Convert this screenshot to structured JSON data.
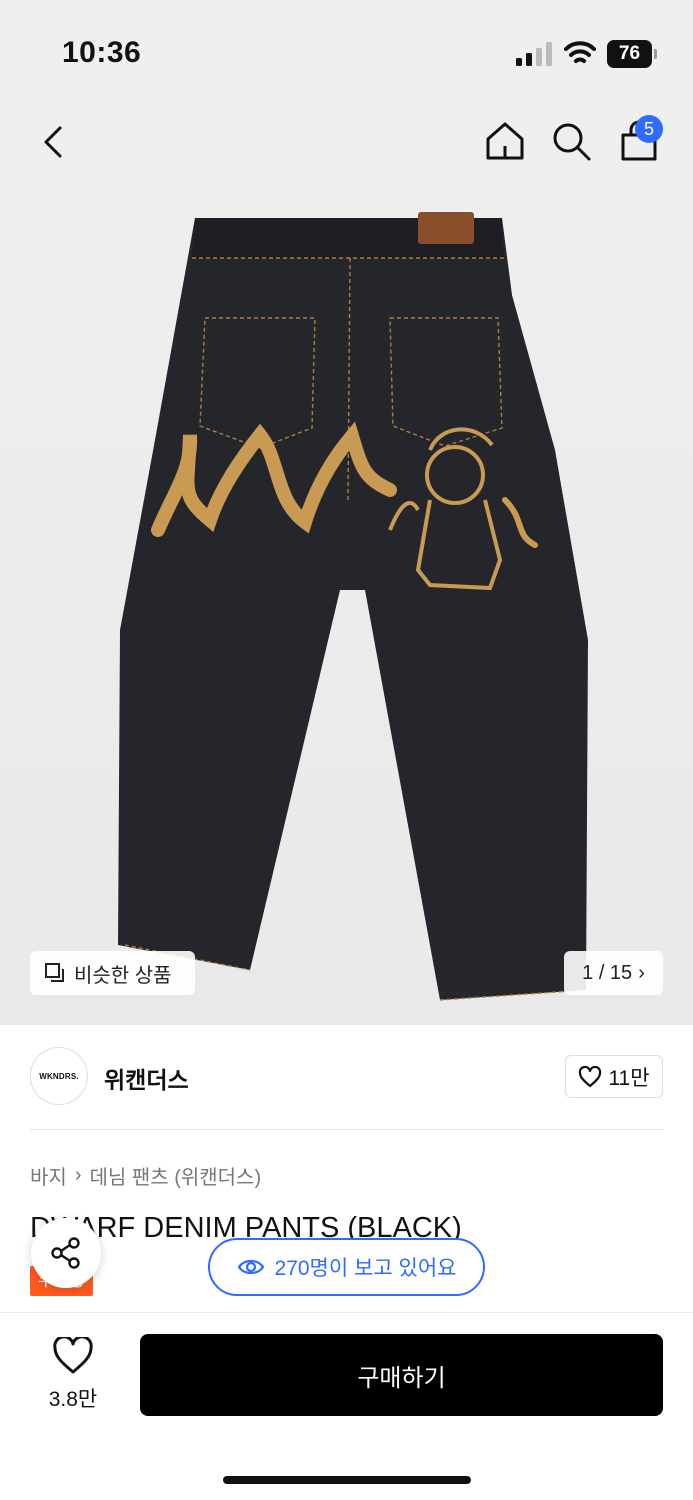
{
  "status_bar": {
    "time": "10:36",
    "battery": "76"
  },
  "nav": {
    "cart_count": "5"
  },
  "gallery": {
    "similar_label": "비슷한 상품",
    "counter": "1 / 15"
  },
  "brand": {
    "logo_text": "WKNDRS.",
    "name": "위캔더스",
    "likes": "11만"
  },
  "breadcrumb": {
    "category": "바지",
    "subcategory": "데님 팬츠 (위캔더스)"
  },
  "product": {
    "title": "DWARF DENIM PANTS (BLACK)",
    "badge": "무진장"
  },
  "viewers": {
    "label": "270명이 보고 있어요"
  },
  "bottom_bar": {
    "wish_count": "3.8만",
    "buy_label": "구매하기"
  },
  "colors": {
    "accent": "#2f6bff",
    "badge": "#ff5a1f",
    "denim": "#23252b",
    "embroidery": "#c99a52"
  },
  "icons": [
    "back-icon",
    "home-icon",
    "search-icon",
    "shopping-bag-icon",
    "similar-icon",
    "chevron-right-icon",
    "heart-icon",
    "share-icon",
    "eye-icon"
  ]
}
